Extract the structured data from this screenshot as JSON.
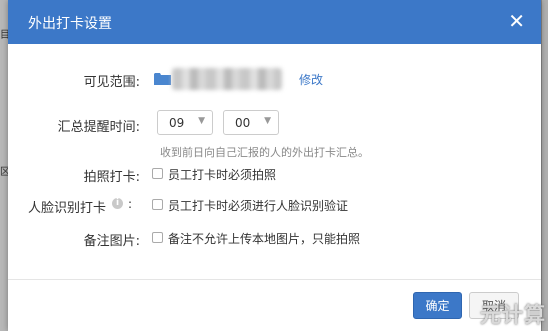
{
  "dialog": {
    "title": "外出打卡设置",
    "close_glyph": "✕"
  },
  "background": {
    "scrap_a": "目",
    "scrap_b": "区"
  },
  "visible_range": {
    "label": "可见范围:",
    "edit_label": "修改"
  },
  "reminder": {
    "label": "汇总提醒时间:",
    "hour": "09",
    "minute": "00",
    "separator": ":",
    "hint": "收到前日向自己汇报的人的外出打卡汇总。"
  },
  "photo_punch": {
    "label": "拍照打卡:",
    "option": "员工打卡时必须拍照"
  },
  "face_punch": {
    "label": "人脸识别打卡",
    "info_glyph": "i",
    "colon": ":",
    "option": "员工打卡时必须进行人脸识别验证"
  },
  "remark_image": {
    "label": "备注图片:",
    "option": "备注不允许上传本地图片，只能拍照"
  },
  "footer": {
    "confirm_label": "确定",
    "cancel_label": "取消"
  },
  "watermark": "元计算",
  "colors": {
    "accent": "#3c78c8",
    "header_text": "#ffffff"
  }
}
